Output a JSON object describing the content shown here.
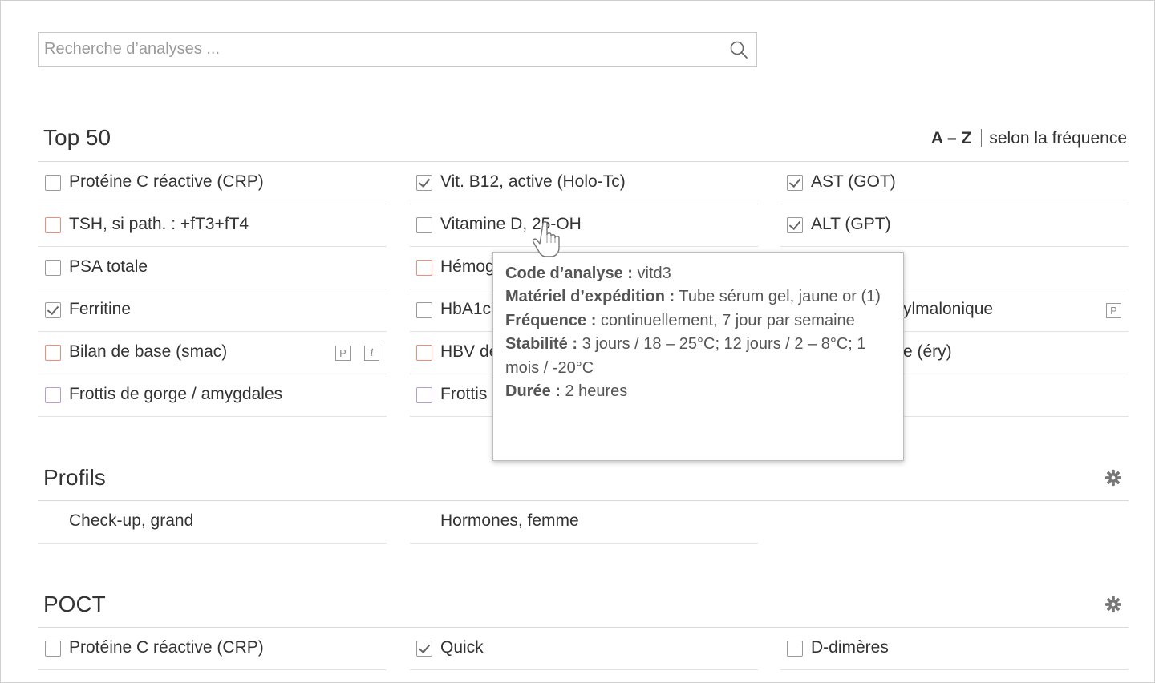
{
  "search": {
    "placeholder": "Recherche d’analyses ..."
  },
  "top50": {
    "title": "Top 50",
    "sort_az": "A – Z",
    "sort_freq": "selon la fréquence",
    "columns": [
      [
        {
          "label": "Protéine C réactive (CRP)",
          "checked": false,
          "border": "gray"
        },
        {
          "label": "TSH, si path. : +fT3+fT4",
          "checked": false,
          "border": "red"
        },
        {
          "label": "PSA totale",
          "checked": false,
          "border": "gray"
        },
        {
          "label": "Ferritine",
          "checked": true,
          "border": "gray"
        },
        {
          "label": "Bilan de base (smac)",
          "checked": false,
          "border": "red",
          "tags": [
            "P",
            "i"
          ]
        },
        {
          "label": "Frottis de gorge / amygdales",
          "checked": false,
          "border": "purple"
        }
      ],
      [
        {
          "label": "Vit. B12, active (Holo-Tc)",
          "checked": true,
          "border": "gray"
        },
        {
          "label": "Vitamine D, 25-OH",
          "checked": false,
          "border": "gray"
        },
        {
          "label": "Hémog",
          "checked": false,
          "border": "red"
        },
        {
          "label": "HbA1c",
          "checked": false,
          "border": "gray"
        },
        {
          "label": "HBV de",
          "checked": false,
          "border": "red"
        },
        {
          "label": "Frottis",
          "checked": false,
          "border": "purple"
        }
      ],
      [
        {
          "label": "AST (GOT)",
          "checked": true,
          "border": "gray"
        },
        {
          "label": "ALT (GPT)",
          "checked": true,
          "border": "gray"
        }
      ]
    ],
    "partial_right": [
      {
        "label": "ylmalonique",
        "tags": [
          "P"
        ]
      },
      {
        "label": "e (éry)"
      }
    ]
  },
  "tooltip": {
    "code_key": "Code d’analyse :",
    "code_val": " vitd3",
    "material_key": "Matériel d’expédition :",
    "material_val": " Tube sérum gel, jaune or (1)",
    "frequency_key": "Fréquence :",
    "frequency_val": " continuellement, 7 jour par semaine",
    "stability_key": "Stabilité :",
    "stability_val": " 3 jours / 18 – 25°C; 12 jours / 2 – 8°C; 1 mois / -20°C",
    "duration_key": "Durée :",
    "duration_val": " 2 heures"
  },
  "profiles": {
    "title": "Profils",
    "items": [
      "Check-up, grand",
      "Hormones, femme"
    ]
  },
  "poct": {
    "title": "POCT",
    "items": [
      {
        "label": "Protéine C réactive (CRP)",
        "checked": false
      },
      {
        "label": "Quick",
        "checked": true
      },
      {
        "label": "D-dimères",
        "checked": false
      }
    ]
  },
  "colors": {
    "red_border": "#ef8c7a",
    "purple_border": "#b89ad6",
    "checkbox_gray": "#9a9a9a",
    "text": "#333333"
  },
  "icons": {
    "search": "search-icon",
    "gear": "gear-icon",
    "cursor": "hand-cursor-icon"
  }
}
